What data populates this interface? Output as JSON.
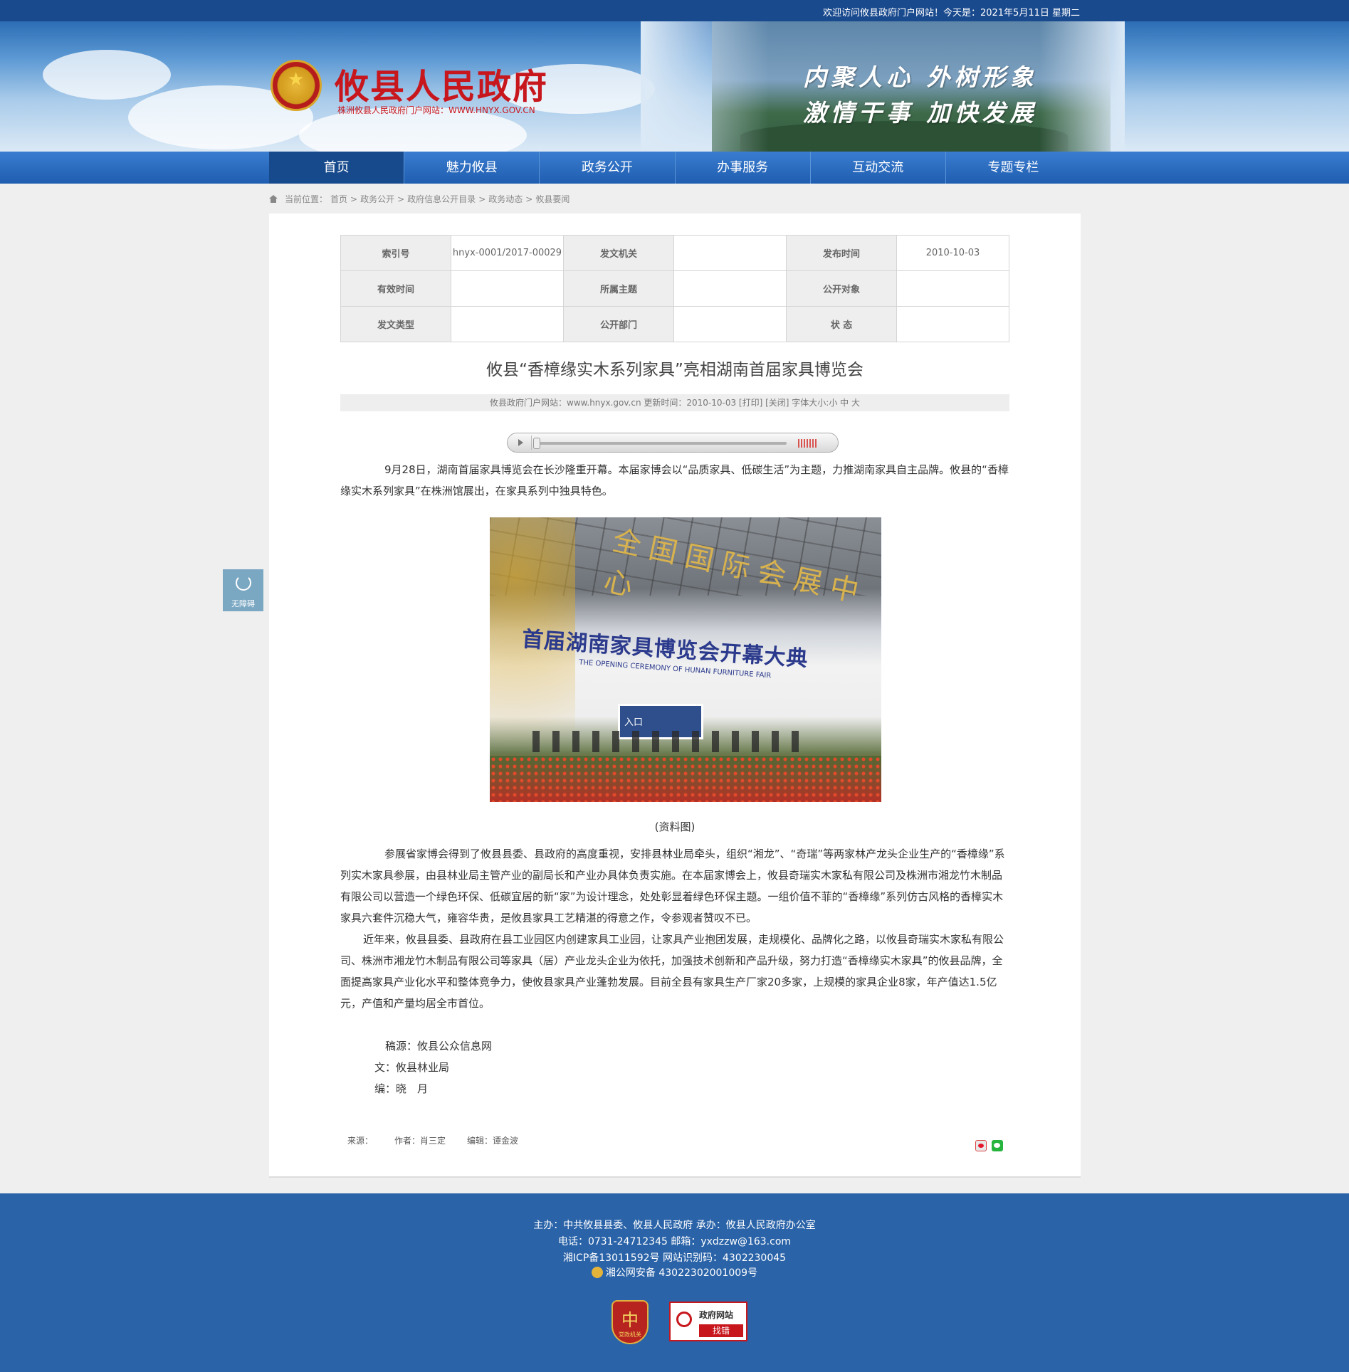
{
  "topbar": {
    "welcome": "欢迎访问攸县政府门户网站！今天是：2021年5月11日 星期二"
  },
  "header": {
    "title": "攸县人民政府",
    "subtitle": "株洲攸县人民政府门户网站：WWW.HNYX.GOV.CN",
    "slogan1": "内聚人心 外树形象",
    "slogan2": "激情干事 加快发展"
  },
  "nav": {
    "items": [
      "首页",
      "魅力攸县",
      "政务公开",
      "办事服务",
      "互动交流",
      "专题专栏"
    ],
    "active_index": 0
  },
  "breadcrumb": {
    "label": "当前位置：",
    "items": [
      "首页",
      "政务公开",
      "政府信息公开目录",
      "政务动态",
      "攸县要闻"
    ],
    "sep": ">"
  },
  "meta": {
    "rows": [
      [
        "索引号",
        "hnyx-0001/2017-00029",
        "发文机关",
        "",
        "发布时间",
        "2010-10-03"
      ],
      [
        "有效时间",
        "",
        "所属主题",
        "",
        "公开对象",
        ""
      ],
      [
        "发文类型",
        "",
        "公开部门",
        "",
        "状 态",
        ""
      ]
    ]
  },
  "article": {
    "title": "攸县“香樟缘实木系列家具”亮相湖南首届家具博览会",
    "info": "攸县政府门户网站：www.hnyx.gov.cn   更新时间：2010-10-03   [打印] [关闭]   字体大小:小 中 大",
    "para1": "9月28日，湖南首届家具博览会在长沙隆重开幕。本届家博会以“品质家具、低碳生活”为主题，力推湖南家具自主品牌。攸县的“香樟缘实木系列家具”在株洲馆展出，在家具系列中独具特色。",
    "photo_sign": "全国国际会展中心",
    "photo_banner": "首届湖南家具博览会开幕大典",
    "photo_banner_en": "THE OPENING CEREMONY OF HUNAN FURNITURE FAIR",
    "photo_door": "入口",
    "caption": "(资料图)",
    "para2": "参展省家博会得到了攸县县委、县政府的高度重视，安排县林业局牵头，组织“湘龙”、“奇瑞”等两家林产龙头企业生产的“香樟缘”系列实木家具参展，由县林业局主管产业的副局长和产业办具体负责实施。在本届家博会上，攸县奇瑞实木家私有限公司及株洲市湘龙竹木制品有限公司以营造一个绿色环保、低碳宜居的新“家”为设计理念，处处彰显着绿色环保主题。一组价值不菲的“香樟缘”系列仿古风格的香樟实木家具六套件沉稳大气，雍容华贵，是攸县家具工艺精湛的得意之作，令参观者赞叹不已。",
    "para3": "近年来，攸县县委、县政府在县工业园区内创建家具工业园，让家具产业抱团发展，走规模化、品牌化之路，以攸县奇瑞实木家私有限公司、株洲市湘龙竹木制品有限公司等家具（居）产业龙头企业为依托，加强技术创新和产品升级，努力打造“香樟缘实木家具”的攸县品牌，全面提高家具产业化水平和整体竞争力，使攸县家具产业蓬勃发展。目前全县有家具生产厂家20多家，上规模的家具企业8家，年产值达1.5亿元，产值和产量均居全市首位。",
    "source_line": "稿源：攸县公众信息网",
    "writer_line": "文：攸县林业局",
    "editor_line": "编：晓　月",
    "byline_source": "来源：",
    "byline_author": "作者：肖三定",
    "byline_editor": "编辑：谭金波"
  },
  "accessibility": {
    "label": "无障碍"
  },
  "footer": {
    "line1": "主办：中共攸县县委、攸县人民政府 承办：攸县人民政府办公室",
    "line2": "电话：0731-24712345 邮箱：yxdzzw@163.com",
    "line3": "湘ICP备13011592号    网站识别码：4302230045",
    "line4": "湘公网安备 43022302001009号",
    "badge1_char": "中",
    "badge1_text": "党政机关",
    "badge2_title": "政府网站",
    "badge2_action": "找错"
  }
}
